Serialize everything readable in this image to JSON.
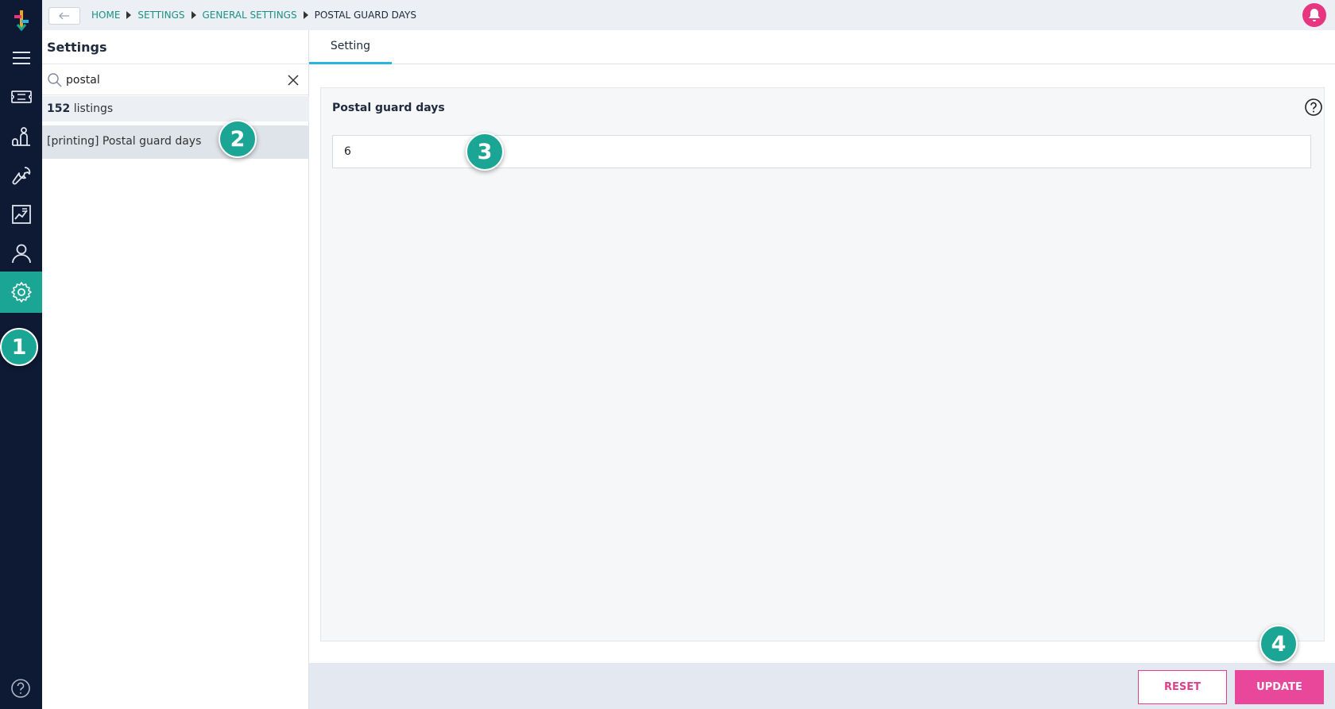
{
  "topbar": {
    "breadcrumb": [
      "HOME",
      "SETTINGS",
      "GENERAL SETTINGS"
    ],
    "breadcrumb_current": "POSTAL GUARD DAYS"
  },
  "sidebar": {
    "items": [
      "menu-icon",
      "ticket-icon",
      "people-icon",
      "wrench-icon",
      "report-icon",
      "user-icon",
      "gear-icon"
    ],
    "active": "gear-icon"
  },
  "panel": {
    "title": "Settings",
    "search_value": "postal",
    "listings_count": "152",
    "listings_label": "listings",
    "result": "[printing] Postal guard days"
  },
  "main": {
    "tab": "Setting",
    "field_label": "Postal guard days",
    "field_value": "6",
    "reset_label": "RESET",
    "update_label": "UPDATE"
  },
  "markers": [
    "1",
    "2",
    "3",
    "4"
  ],
  "colors": {
    "rail": "#0e1a33",
    "accent": "#1ba594",
    "brand_pink": "#e8479a",
    "tab_underline": "#27b5e4"
  }
}
